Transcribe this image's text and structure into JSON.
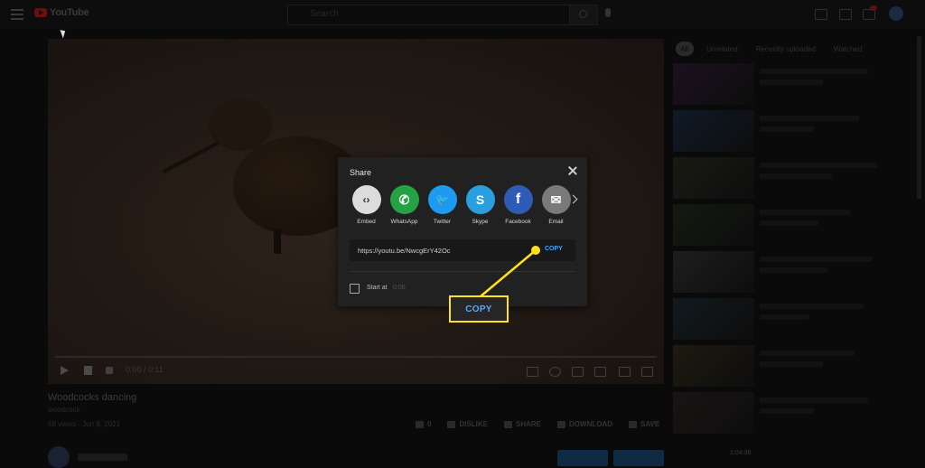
{
  "header": {
    "logo_text": "YouTube",
    "search_placeholder": "Search"
  },
  "video": {
    "time": "0:00 / 0:11",
    "title": "Woodcocks dancing",
    "channel": "woodcock",
    "views": "48 views · Jun 8, 2021"
  },
  "actions": {
    "like_count": "0",
    "dislike": "DISLIKE",
    "share": "SHARE",
    "download": "DOWNLOAD",
    "save": "SAVE"
  },
  "sidebar": {
    "chips": [
      "All",
      "Unrelated",
      "Recently uploaded",
      "Watched"
    ],
    "duration_badge": "1:04:36"
  },
  "share_dialog": {
    "title": "Share",
    "targets": [
      {
        "label": "Embed",
        "icon": "embed-icon",
        "color": "#dcdcdc",
        "glyph": "‹›"
      },
      {
        "label": "WhatsApp",
        "icon": "whatsapp-icon",
        "color": "#25a244",
        "glyph": "✆"
      },
      {
        "label": "Twitter",
        "icon": "twitter-icon",
        "color": "#1d9bf0",
        "glyph": "🐦"
      },
      {
        "label": "Skype",
        "icon": "skype-icon",
        "color": "#2a9fe0",
        "glyph": "S"
      },
      {
        "label": "Facebook",
        "icon": "facebook-icon",
        "color": "#2d5bb5",
        "glyph": "f"
      },
      {
        "label": "Email",
        "icon": "email-icon",
        "color": "#7a7a7a",
        "glyph": "✉"
      }
    ],
    "url": "https://youtu.be/NwcgErY42Oc",
    "copy_label": "COPY",
    "start_at_label": "Start at",
    "start_at_time": "0:00"
  },
  "callout": {
    "label": "COPY",
    "color": "#ffe01a"
  }
}
